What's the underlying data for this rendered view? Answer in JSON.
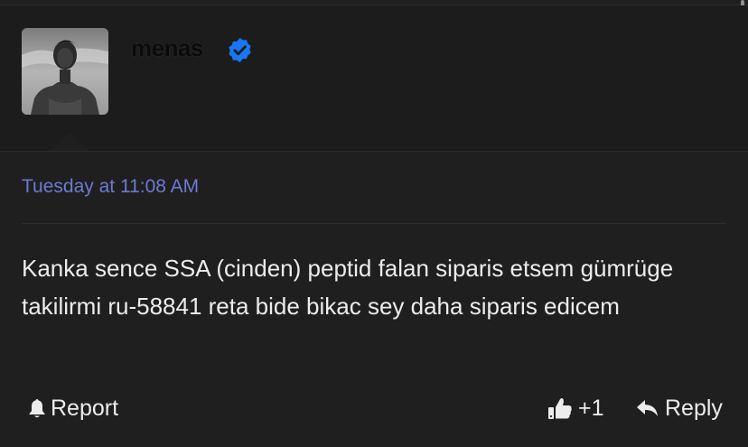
{
  "post": {
    "username": "menas",
    "timestamp": "Tuesday at 11:08 AM",
    "body": "Kanka sence SSA (cinden) peptid falan siparis etsem gümrüge takilirmi ru-58841 reta bide bikac sey daha siparis edicem"
  },
  "actions": {
    "report_label": "Report",
    "like_count": "+1",
    "reply_label": "Reply"
  },
  "icons": {
    "avatar": "user-avatar-photo",
    "verified": "verified-check-icon",
    "report": "bell-icon",
    "like": "thumbs-up-icon",
    "reply": "reply-arrow-icon"
  },
  "colors": {
    "background": "#1f1f20",
    "timestamp": "#6d7ad1",
    "verified_badge": "#1877f2",
    "text": "#ececec"
  }
}
